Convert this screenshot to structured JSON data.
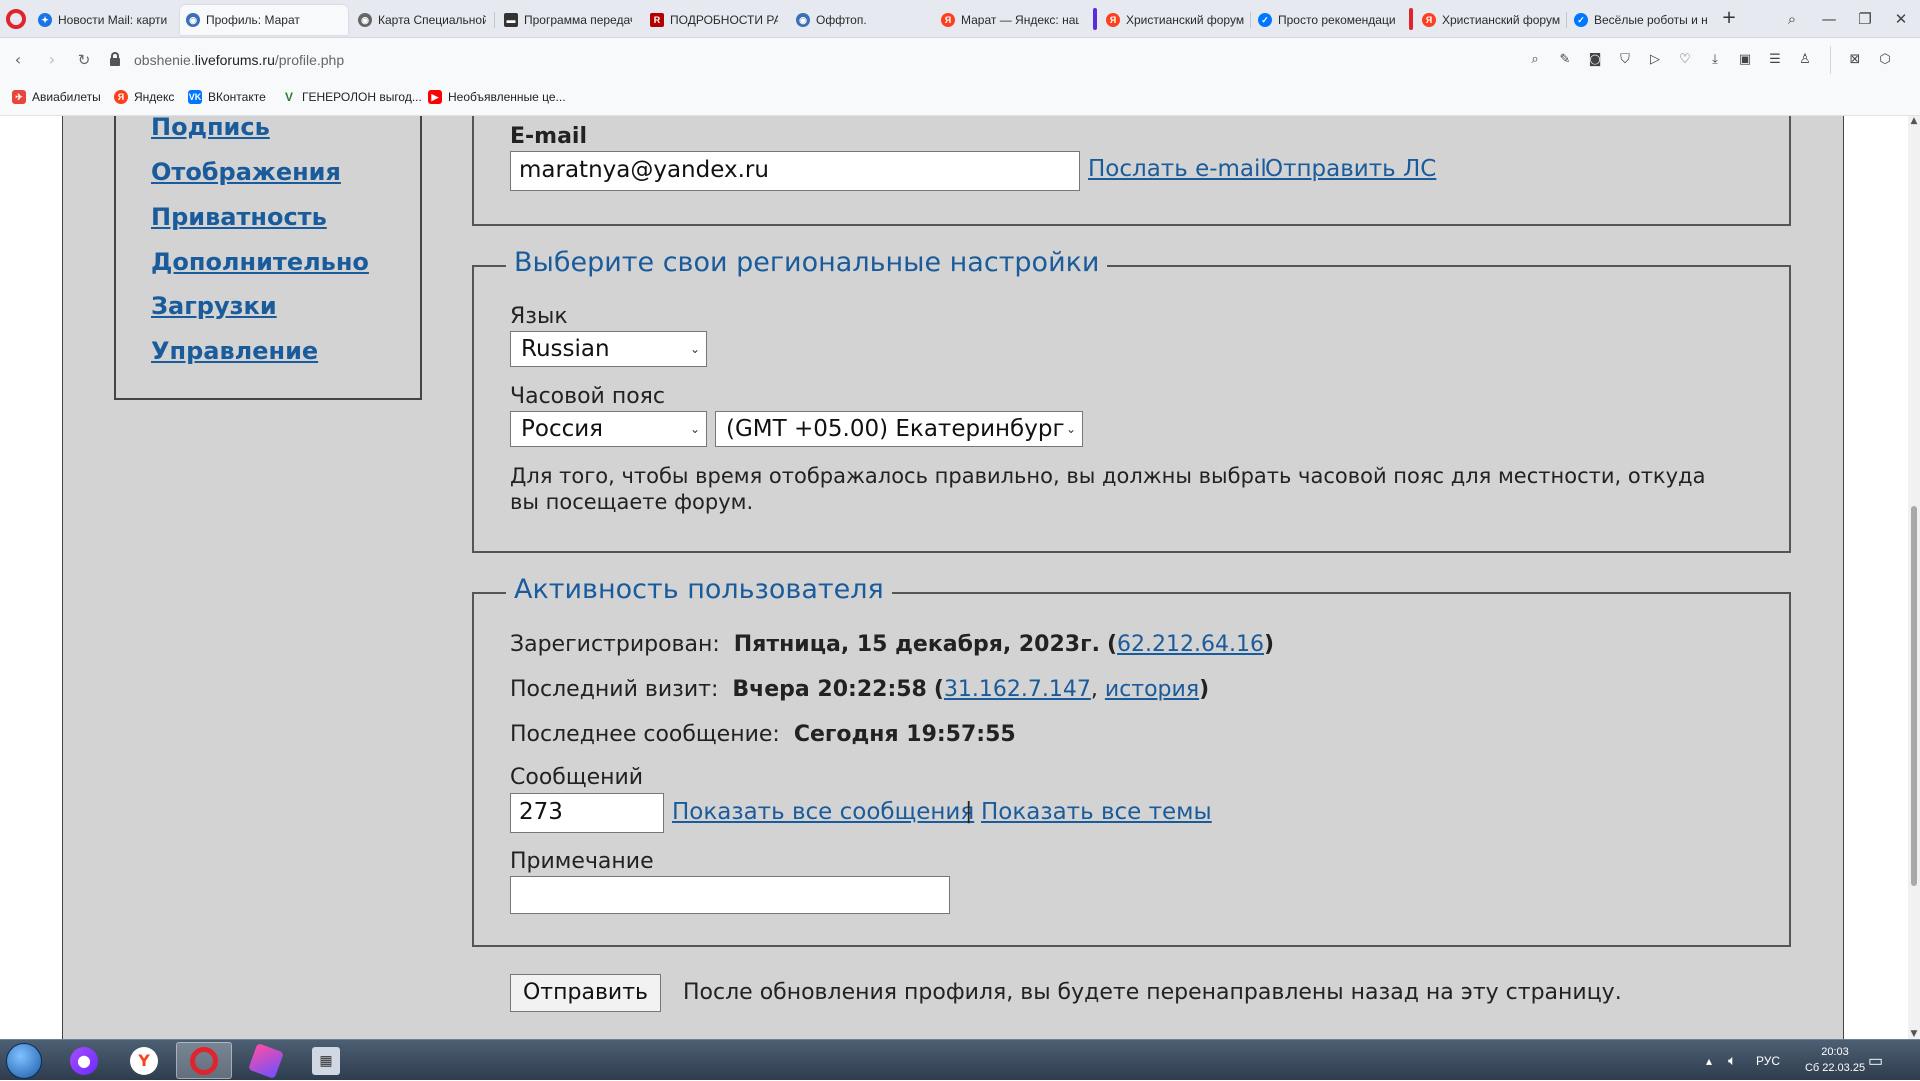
{
  "browser": {
    "tabs": [
      {
        "title": "Новости Mail: картин",
        "favicon": "mail-news-icon",
        "color": "#1a73e8"
      },
      {
        "title": "Профиль: Марат",
        "favicon": "liveforums-icon",
        "color": "#3b6fb6"
      },
      {
        "title": "Карта Специальной в",
        "favicon": "map-icon",
        "color": "#666666"
      },
      {
        "title": "Программа передач",
        "favicon": "tv-icon",
        "color": "#333333"
      },
      {
        "title": "ПОДРОБНОСТИ РАЗГ",
        "favicon": "news-icon",
        "color": "#b40000"
      },
      {
        "title": "Оффтоп.",
        "favicon": "liveforums-icon",
        "color": "#3b6fb6"
      },
      {
        "title": "Марат — Яндекс: нащ",
        "favicon": "yandex-icon",
        "color": "#fc3f1d"
      },
      {
        "title": "Христианский форум",
        "favicon": "yandex-icon",
        "color": "#fc3f1d"
      },
      {
        "title": "Просто рекомендаци",
        "favicon": "vk-icon",
        "color": "#0077ff"
      },
      {
        "title": "Христианский форум",
        "favicon": "yandex-icon",
        "color": "#fc3f1d"
      },
      {
        "title": "Весёлые роботы и не",
        "favicon": "vk-icon",
        "color": "#0077ff"
      }
    ],
    "url": {
      "prefix": "obshenie.",
      "host": "liveforums.ru",
      "path": "/profile.php"
    },
    "bookmarks": [
      {
        "label": "Авиабилеты",
        "icon": "ticket-icon",
        "color": "#e8463b"
      },
      {
        "label": "Яндекс",
        "icon": "yandex-icon",
        "color": "#fc3f1d"
      },
      {
        "label": "ВКонтакте",
        "icon": "vk-icon",
        "color": "#0077ff"
      },
      {
        "label": "ГЕНЕРОЛОН выгод...",
        "icon": "v-icon",
        "color": "#2e7d32"
      },
      {
        "label": "Необъявленные це...",
        "icon": "youtube-icon",
        "color": "#ff0000"
      }
    ]
  },
  "sidebar": {
    "items": [
      "Подпись",
      "Отображения",
      "Приватность",
      "Дополнительно",
      "Загрузки",
      "Управление"
    ]
  },
  "email_section": {
    "label": "E-mail",
    "value": "maratnya@yandex.ru",
    "send_email_link": "Послать e-mail",
    "send_pm_link": "Отправить ЛС"
  },
  "regional": {
    "legend": "Выберите свои региональные настройки",
    "language_label": "Язык",
    "language_value": "Russian",
    "timezone_label": "Часовой пояс",
    "country_value": "Россия",
    "timezone_value": "(GMT +05.00) Екатеринбург",
    "hint": "Для того, чтобы время отображалось правильно, вы должны выбрать часовой пояс для местности, откуда",
    "hint2": "вы посещаете форум."
  },
  "activity": {
    "legend": "Активность пользователя",
    "registered_label": "Зарегистрирован:",
    "registered_value": "Пятница, 15 декабря, 2023г.",
    "registered_ip": "62.212.64.16",
    "last_visit_label": "Последний визит:",
    "last_visit_value": "Вчера 20:22:58",
    "last_visit_ip": "31.162.7.147",
    "history_link": "история",
    "last_post_label": "Последнее сообщение:",
    "last_post_value": "Сегодня 19:57:55",
    "posts_label": "Сообщений",
    "posts_value": "273",
    "show_posts_link": "Показать все сообщения",
    "separator": "|",
    "show_topics_link": "Показать все темы",
    "note_label": "Примечание",
    "note_value": ""
  },
  "footer": {
    "submit_label": "Отправить",
    "submit_hint": "После обновления профиля, вы будете перенаправлены назад на эту страницу."
  },
  "taskbar": {
    "language": "РУС",
    "time": "20:03",
    "date": "Сб 22.03.25"
  }
}
